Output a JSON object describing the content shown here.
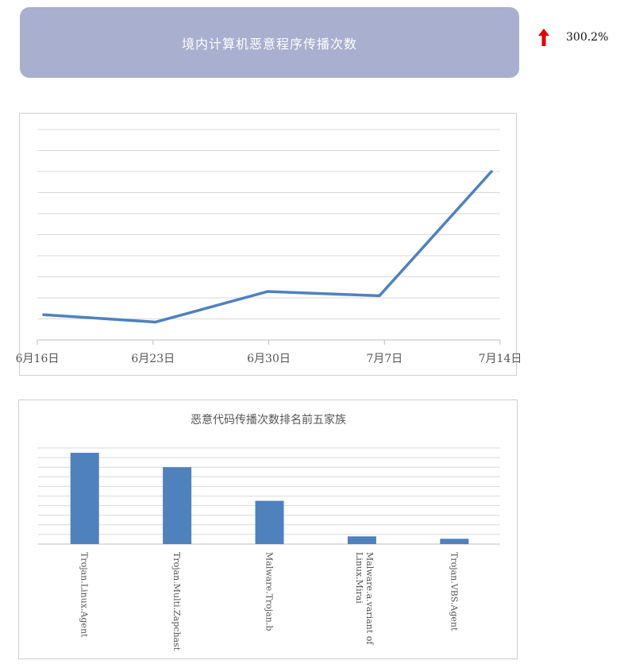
{
  "header": {
    "title": "境内计算机恶意程序传播次数"
  },
  "change": {
    "value": "300.2%",
    "direction": "up",
    "icon": "arrow-up-icon",
    "color": "#e00000"
  },
  "colors": {
    "header_bg": "#a8afcf",
    "series": "#4f81bd",
    "grid": "#d9d9d9"
  },
  "chart_data": [
    {
      "type": "line",
      "title": "",
      "categories": [
        "6月16日",
        "6月23日",
        "6月30日",
        "7月7日",
        "7月14日"
      ],
      "series": [
        {
          "values": [
            1.2,
            0.85,
            2.3,
            2.1,
            8.0
          ]
        }
      ],
      "ylim": [
        0,
        10
      ],
      "grid": true,
      "legend": "none"
    },
    {
      "type": "bar",
      "title": "恶意代码传播次数排名前五家族",
      "categories": [
        "Trojan.Linux.Agent",
        "Trojan.Multi.Zapchast",
        "Malware.Trojan.b",
        "Malware.a.variant of Linux.Mirai",
        "Trojan.VBS.Agent"
      ],
      "values": [
        9.5,
        8.0,
        4.5,
        0.8,
        0.55
      ],
      "ylim": [
        0,
        10
      ],
      "grid": true,
      "legend": "none"
    }
  ]
}
